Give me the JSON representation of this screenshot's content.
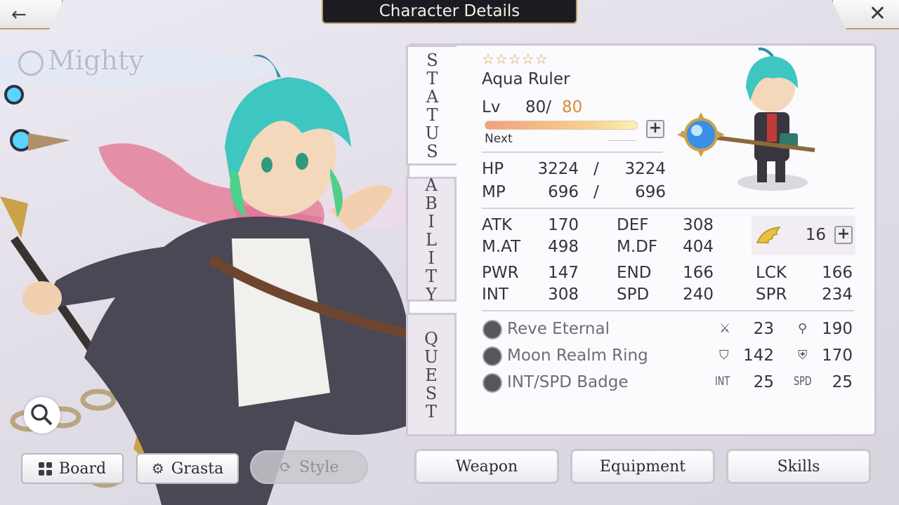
{
  "header": {
    "title": "Character Details"
  },
  "hero": {
    "class_label": "Mighty"
  },
  "status": {
    "stars": "☆☆☆☆☆",
    "name": "Aqua Ruler",
    "lv_label": "Lv",
    "lv_current": "80/",
    "lv_max": "80",
    "next_label": "Next",
    "exp_progress": 1.0
  },
  "tabs": {
    "status": "STATUS",
    "ability": "ABILITY",
    "quest": "QUEST"
  },
  "vitals": {
    "hp_label": "HP",
    "hp": "3224",
    "hp_sep": "/",
    "hp_max": "3224",
    "mp_label": "MP",
    "mp": "696",
    "mp_sep": "/",
    "mp_max": "696"
  },
  "stats": {
    "atk_label": "ATK",
    "atk": "170",
    "def_label": "DEF",
    "def": "308",
    "mat_label": "M.AT",
    "mat": "498",
    "mdf_label": "M.DF",
    "mdf": "404",
    "pwr_label": "PWR",
    "pwr": "147",
    "end_label": "END",
    "end": "166",
    "lck_label": "LCK",
    "lck": "166",
    "int_label": "INT",
    "int": "308",
    "spd_label": "SPD",
    "spd": "240",
    "spr_label": "SPR",
    "spr": "234",
    "wing_count": "16"
  },
  "equipment": [
    {
      "name": "Reve Eternal",
      "v1": "23",
      "v2": "190",
      "icon": "weapon-icon",
      "i1": "sword-icon",
      "i2": "staff-icon"
    },
    {
      "name": "Moon Realm Ring",
      "v1": "142",
      "v2": "170",
      "icon": "ring-icon",
      "i1": "shield-icon",
      "i2": "cross-shield-icon"
    },
    {
      "name": "INT/SPD Badge",
      "v1": "25",
      "v2": "25",
      "icon": "badge-icon",
      "i1_text": "INT",
      "i2_text": "SPD"
    }
  ],
  "left_buttons": {
    "board": "Board",
    "grasta": "Grasta",
    "style": "Style"
  },
  "right_buttons": {
    "weapon": "Weapon",
    "equipment": "Equipment",
    "skills": "Skills"
  },
  "colors": {
    "accent_gold": "#b9a06a",
    "level_max": "#d88a3a",
    "hair": "#3ec6c0"
  }
}
